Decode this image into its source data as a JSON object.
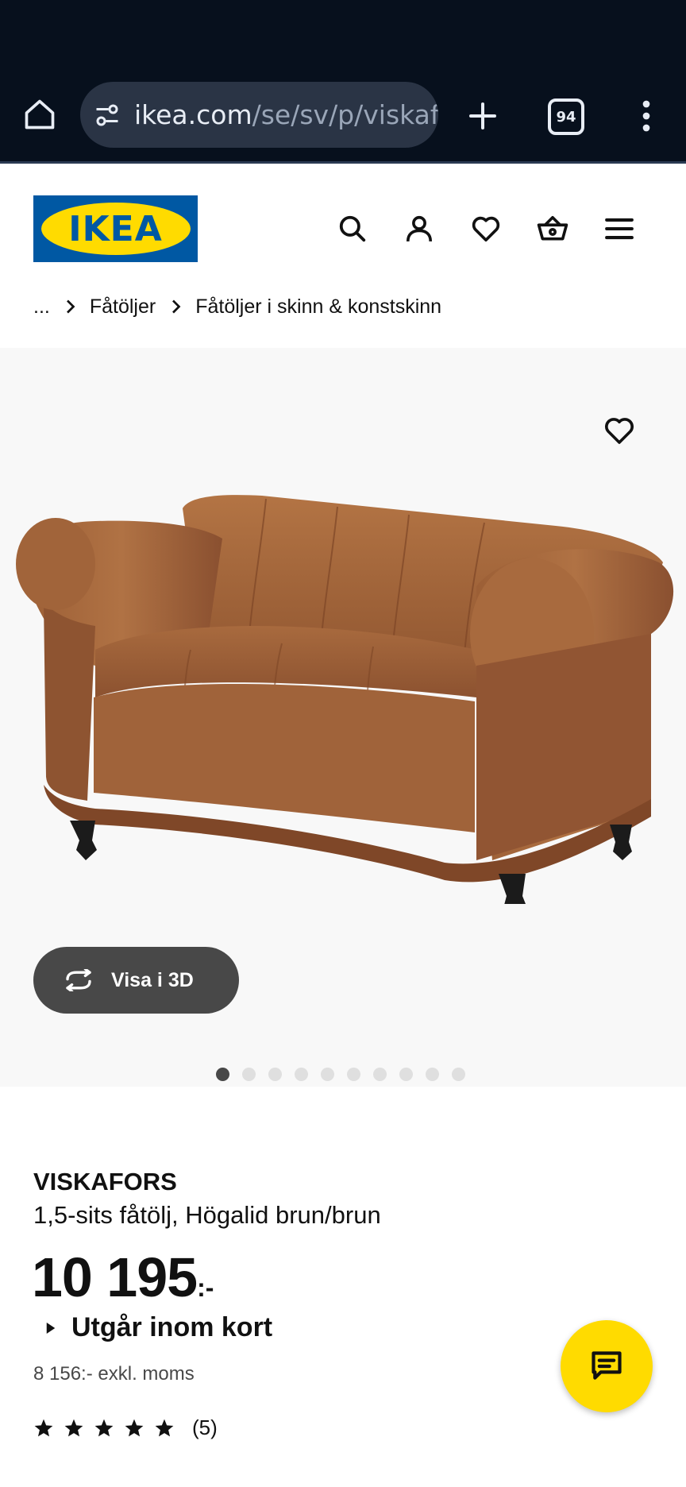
{
  "browser": {
    "url_host": "ikea.com",
    "url_path": "/se/sv/p/viskafo",
    "tab_count": "94",
    "bg_color": "#07101d"
  },
  "header": {
    "logo_text": "IKEA",
    "icons": [
      "search-icon",
      "user-icon",
      "heart-icon",
      "cart-icon",
      "menu-icon"
    ]
  },
  "breadcrumb": {
    "items": [
      "...",
      "Fåtöljer",
      "Fåtöljer i skinn & konstskinn"
    ]
  },
  "gallery": {
    "view3d_label": "Visa i 3D",
    "image_count": 10,
    "active_index": 0
  },
  "product": {
    "name": "VISKAFORS",
    "description": "1,5-sits fåtölj, Högalid brun/brun",
    "price": "10 195",
    "price_suffix": ":-",
    "availability": "Utgår inom kort",
    "price_excl_vat": "8 156:- exkl. moms",
    "rating": 5,
    "review_count": "(5)"
  },
  "colors": {
    "ikea_blue": "#0058a3",
    "ikea_yellow": "#ffdb00",
    "button_dark": "#484848",
    "leather": "#a86a3e"
  }
}
